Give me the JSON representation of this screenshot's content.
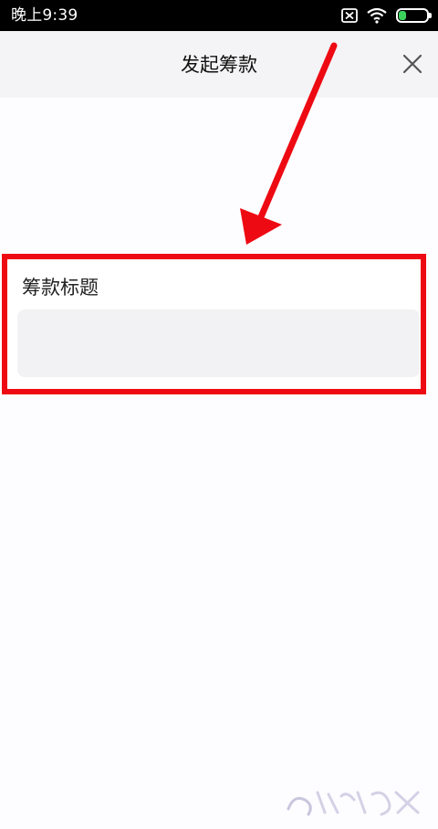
{
  "status_bar": {
    "time": "晚上9:39",
    "battery_level": 25,
    "battery_label": "25",
    "battery_color": "#3bd15b",
    "icons": [
      "sim-off-icon",
      "wifi-icon",
      "battery-icon"
    ]
  },
  "header": {
    "title": "发起筹款",
    "close_icon": "close-icon"
  },
  "form": {
    "title_label": "筹款标题",
    "title_value": ""
  },
  "annotation": {
    "highlight_color": "#ee0a12",
    "arrow_color": "#ee0a12"
  }
}
